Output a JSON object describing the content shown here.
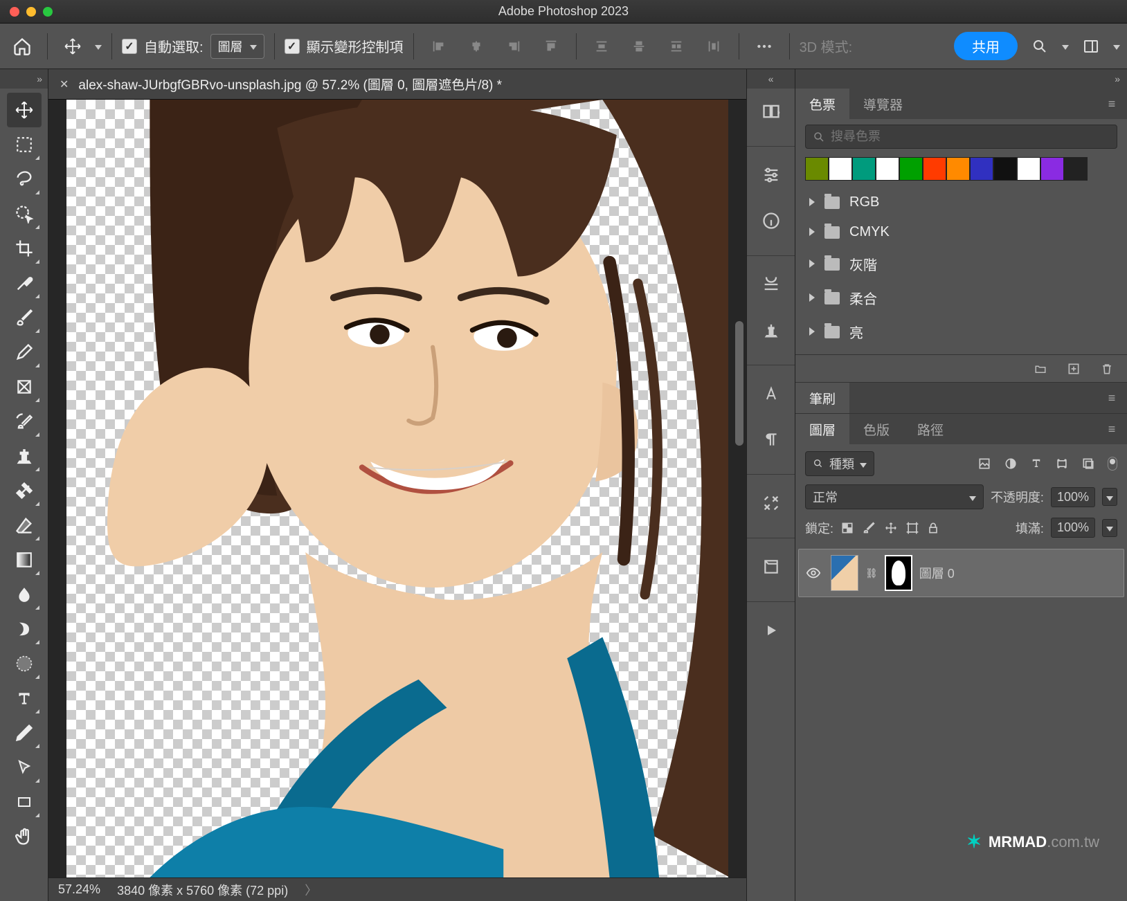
{
  "titlebar": {
    "title": "Adobe Photoshop 2023"
  },
  "optbar": {
    "auto_select_label": "自動選取:",
    "auto_select_value": "圖層",
    "transform_label": "顯示變形控制項",
    "mode3d_label": "3D 模式:",
    "share_label": "共用"
  },
  "doc_tab": {
    "title": "alex-shaw-JUrbgfGBRvo-unsplash.jpg @ 57.2% (圖層 0, 圖層遮色片/8) *"
  },
  "statusbar": {
    "zoom": "57.24%",
    "info": "3840 像素 x 5760 像素 (72 ppi)"
  },
  "swatches_panel": {
    "tab_swatches": "色票",
    "tab_navigator": "導覽器",
    "search_placeholder": "搜尋色票",
    "colors": [
      "#6a8a00",
      "#ffffff",
      "#009b7d",
      "#ffffff",
      "#00a000",
      "#ff3b00",
      "#ff8a00",
      "#3030c0",
      "#111111",
      "#ffffff",
      "#8a2be2",
      "#222222"
    ],
    "groups": [
      "RGB",
      "CMYK",
      "灰階",
      "柔合",
      "亮"
    ]
  },
  "brush_panel": {
    "tab_brush": "筆刷"
  },
  "layers_panel": {
    "tab_layers": "圖層",
    "tab_channels": "色版",
    "tab_paths": "路徑",
    "filter_label": "種類",
    "blend_mode": "正常",
    "opacity_label": "不透明度:",
    "opacity_value": "100%",
    "lock_label": "鎖定:",
    "fill_label": "填滿:",
    "fill_value": "100%",
    "layer0_name": "圖層 0"
  },
  "watermark": {
    "brand": "MRMAD",
    "domain": ".com.tw"
  }
}
